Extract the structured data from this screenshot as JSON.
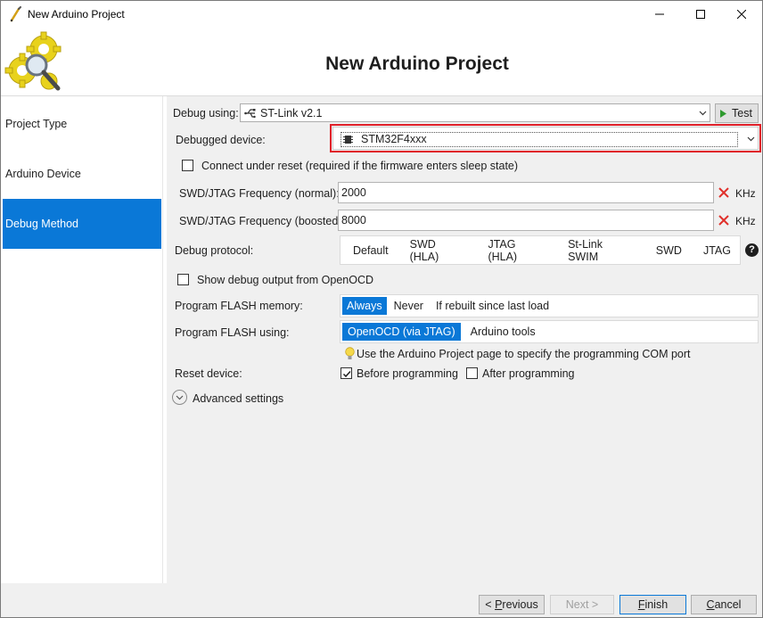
{
  "window": {
    "title": "New Arduino Project"
  },
  "header": {
    "title": "New Arduino Project"
  },
  "sidebar": {
    "items": [
      {
        "label": "Project Type",
        "active": false
      },
      {
        "label": "Arduino Device",
        "active": false
      },
      {
        "label": "Debug Method",
        "active": true
      }
    ]
  },
  "debug": {
    "using_label": "Debug using:",
    "using_value": "ST-Link v2.1",
    "test_label": "Test",
    "device_label": "Debugged device:",
    "device_value": "STM32F4xxx",
    "connect_under_reset": {
      "label": "Connect under reset (required if the firmware enters sleep state)",
      "checked": false
    },
    "freq_normal_label": "SWD/JTAG Frequency (normal):",
    "freq_normal_value": "2000",
    "freq_boosted_label": "SWD/JTAG Frequency (boosted):",
    "freq_boosted_value": "8000",
    "freq_unit": "KHz",
    "protocol_label": "Debug protocol:",
    "protocol_options": [
      "Default",
      "SWD (HLA)",
      "JTAG (HLA)",
      "St-Link SWIM",
      "SWD",
      "JTAG"
    ],
    "help_symbol": "?",
    "show_output": {
      "label": "Show debug output from OpenOCD",
      "checked": false
    },
    "flash_memory_label": "Program FLASH memory:",
    "flash_memory_options": [
      "Always",
      "Never",
      "If rebuilt since last load"
    ],
    "flash_memory_selected": "Always",
    "flash_using_label": "Program FLASH using:",
    "flash_using_options": [
      "OpenOCD (via JTAG)",
      "Arduino tools"
    ],
    "flash_using_selected": "OpenOCD (via JTAG)",
    "hint": "Use the Arduino Project page to specify the programming COM port",
    "reset_label": "Reset device:",
    "reset_before": {
      "label": "Before programming",
      "checked": true
    },
    "reset_after": {
      "label": "After programming",
      "checked": false
    },
    "advanced_label": "Advanced settings"
  },
  "footer": {
    "previous": {
      "underline": "P",
      "rest": "revious",
      "prefix": "< "
    },
    "next": {
      "label": "Next >",
      "enabled": false
    },
    "finish": {
      "underline": "F",
      "rest": "inish"
    },
    "cancel": {
      "underline": "C",
      "rest": "ancel"
    }
  },
  "colors": {
    "accent": "#0a78d7",
    "highlight": "#e0202a",
    "panel": "#f0f0f0"
  }
}
